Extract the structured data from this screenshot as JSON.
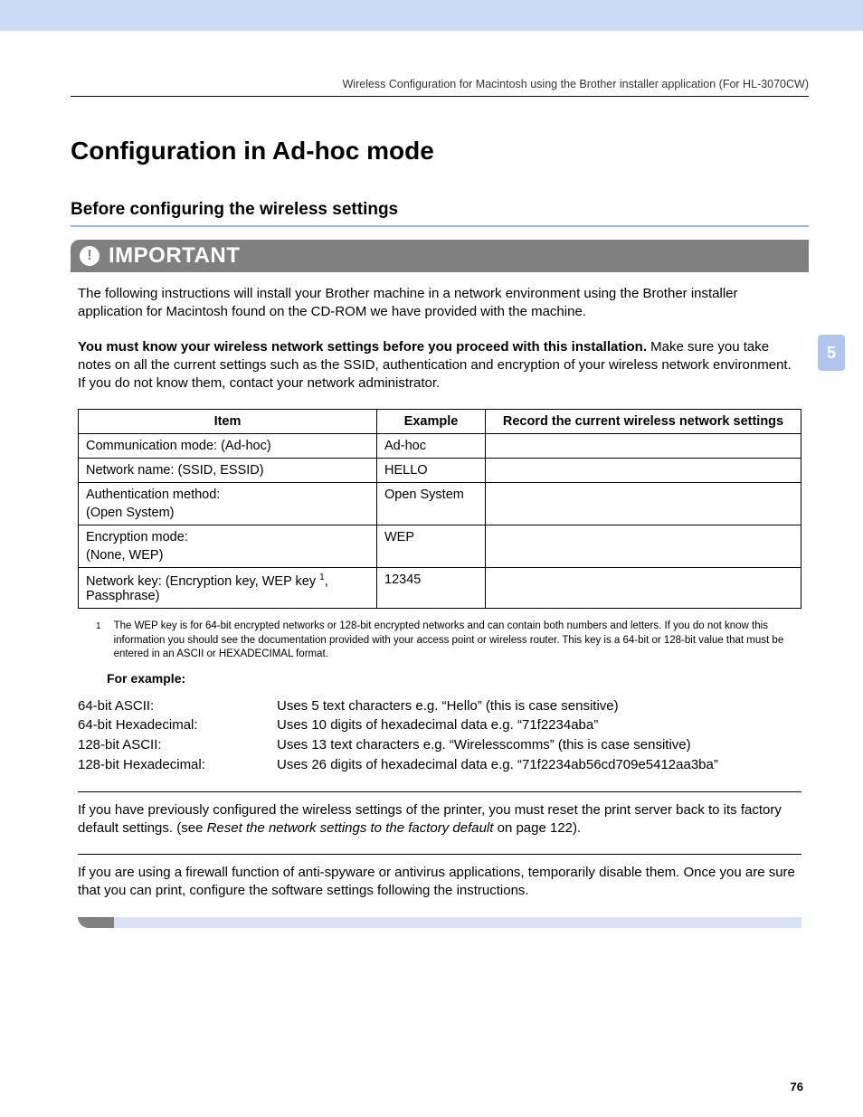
{
  "header": "Wireless Configuration for Macintosh using the Brother installer application (For HL-3070CW)",
  "title": "Configuration in Ad-hoc mode",
  "subtitle": "Before configuring the wireless settings",
  "important_label": "IMPORTANT",
  "chapter_tab": "5",
  "page_number": "76",
  "p1": "The following instructions will install your Brother machine in a network environment using the Brother installer application for Macintosh found on the CD-ROM we have provided with the machine.",
  "p2_bold": "You must know your wireless network settings before you proceed with this installation.",
  "p2_rest": " Make sure you take notes on all the current settings such as the SSID, authentication and encryption of your wireless network environment. If you do not know them, contact your network administrator.",
  "table": {
    "headers": [
      "Item",
      "Example",
      "Record the current wireless network settings"
    ],
    "rows": [
      {
        "item": "Communication mode: (Ad-hoc)",
        "sub": "",
        "example": "Ad-hoc",
        "record": ""
      },
      {
        "item": "Network name: (SSID, ESSID)",
        "sub": "",
        "example": "HELLO",
        "record": ""
      },
      {
        "item": "Authentication method:",
        "sub": "(Open System)",
        "example": "Open System",
        "record": ""
      },
      {
        "item": "Encryption mode:",
        "sub": "(None, WEP)",
        "example": "WEP",
        "record": ""
      },
      {
        "item_pre": "Network key: (Encryption key, WEP key ",
        "sup": "1",
        "item_post": ", Passphrase)",
        "example": "12345",
        "record": ""
      }
    ]
  },
  "footnote": {
    "num": "1",
    "text": "The WEP key is for 64-bit encrypted networks or 128-bit encrypted networks and can contain both numbers and letters. If you do not know this information you should see the documentation provided with your access point or wireless router. This key is a 64-bit or 128-bit value that must be entered in an ASCII or HEXADECIMAL format."
  },
  "for_example": "For example:",
  "examples": [
    {
      "label": "64-bit ASCII:",
      "desc": "Uses 5 text characters e.g. “Hello” (this is case sensitive)"
    },
    {
      "label": "64-bit Hexadecimal:",
      "desc": "Uses 10 digits of hexadecimal data e.g. “71f2234aba”"
    },
    {
      "label": "128-bit ASCII:",
      "desc": "Uses 13 text characters e.g. “Wirelesscomms” (this is case sensitive)"
    },
    {
      "label": "128-bit Hexadecimal:",
      "desc": "Uses 26 digits of hexadecimal data e.g. “71f2234ab56cd709e5412aa3ba”"
    }
  ],
  "p3_a": "If you have previously configured the wireless settings of the printer, you must reset the print server back to its factory default settings. (see ",
  "p3_italic": "Reset the network settings to the factory default",
  "p3_b": " on page 122).",
  "p4": "If you are using a firewall function of anti-spyware or antivirus applications, temporarily disable them. Once you are sure that you can print, configure the software settings following the instructions."
}
